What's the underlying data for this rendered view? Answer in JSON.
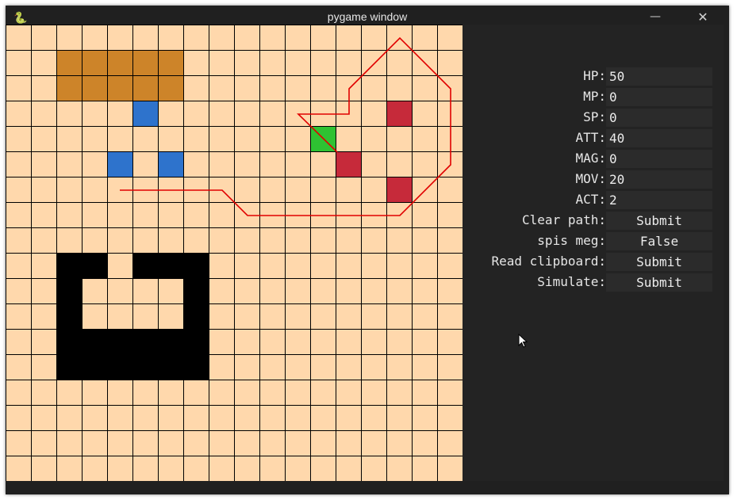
{
  "window": {
    "title": "pygame window",
    "icon": "pygame-snake-icon",
    "minimize_glyph": "—",
    "close_glyph": "✕"
  },
  "grid": {
    "rows": 18,
    "cols": 18,
    "background": "#ffd8ac",
    "line_color": "#000000",
    "orange_cells": [
      [
        2,
        1
      ],
      [
        3,
        1
      ],
      [
        4,
        1
      ],
      [
        5,
        1
      ],
      [
        6,
        1
      ],
      [
        2,
        2
      ],
      [
        3,
        2
      ],
      [
        4,
        2
      ],
      [
        5,
        2
      ],
      [
        6,
        2
      ]
    ],
    "blue_cells": [
      [
        5,
        3
      ],
      [
        4,
        5
      ],
      [
        6,
        5
      ]
    ],
    "red_cells": [
      [
        15,
        3
      ],
      [
        13,
        5
      ],
      [
        15,
        6
      ]
    ],
    "green_cells": [
      [
        12,
        4
      ]
    ],
    "black_cells": [
      [
        2,
        9
      ],
      [
        3,
        9
      ],
      [
        5,
        9
      ],
      [
        6,
        9
      ],
      [
        7,
        9
      ],
      [
        2,
        10
      ],
      [
        7,
        10
      ],
      [
        2,
        11
      ],
      [
        7,
        11
      ],
      [
        2,
        12
      ],
      [
        3,
        12
      ],
      [
        4,
        12
      ],
      [
        5,
        12
      ],
      [
        6,
        12
      ],
      [
        7,
        12
      ],
      [
        2,
        13
      ],
      [
        3,
        13
      ],
      [
        4,
        13
      ],
      [
        5,
        13
      ],
      [
        6,
        13
      ],
      [
        7,
        13
      ]
    ],
    "colors": {
      "orange": "#cd8429",
      "blue": "#2e73cc",
      "red": "#c62a3a",
      "green": "#2ec232",
      "black": "#000000",
      "path": "#e00000"
    }
  },
  "stats": [
    {
      "key": "hp",
      "label": "HP:",
      "value": "50",
      "button": false
    },
    {
      "key": "mp",
      "label": "MP:",
      "value": "0",
      "button": false
    },
    {
      "key": "sp",
      "label": "SP:",
      "value": "0",
      "button": false
    },
    {
      "key": "att",
      "label": "ATT:",
      "value": "40",
      "button": false
    },
    {
      "key": "mag",
      "label": "MAG:",
      "value": "0",
      "button": false
    },
    {
      "key": "mov",
      "label": "MOV:",
      "value": "20",
      "button": false
    },
    {
      "key": "act",
      "label": "ACT:",
      "value": "2",
      "button": false
    },
    {
      "key": "clear-path",
      "label": "Clear path:",
      "value": "Submit",
      "button": true
    },
    {
      "key": "spis-meg",
      "label": "spis meg:",
      "value": "False",
      "button": true
    },
    {
      "key": "read-clipboard",
      "label": "Read clipboard:",
      "value": "Submit",
      "button": true
    },
    {
      "key": "simulate",
      "label": "Simulate:",
      "value": "Submit",
      "button": true
    }
  ]
}
